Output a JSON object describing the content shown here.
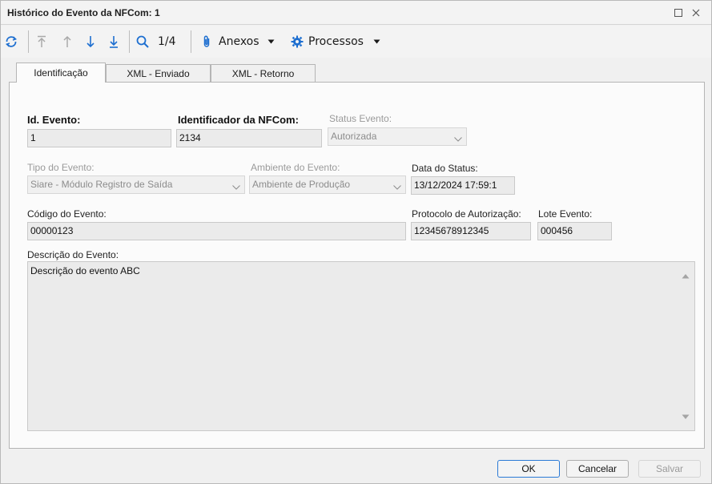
{
  "window": {
    "title": "Histórico do Evento da NFCom: 1"
  },
  "toolbar": {
    "counter": "1/4",
    "anexos_label": "Anexos",
    "processos_label": "Processos"
  },
  "tabs": [
    {
      "label": "Identificação",
      "active": true
    },
    {
      "label": "XML - Enviado",
      "active": false
    },
    {
      "label": "XML - Retorno",
      "active": false
    }
  ],
  "form": {
    "id_evento": {
      "label": "Id. Evento:",
      "value": "1"
    },
    "identificador_nfcom": {
      "label": "Identificador da NFCom:",
      "value": "2134"
    },
    "status_evento": {
      "label": "Status Evento:",
      "value": "Autorizada"
    },
    "tipo_evento": {
      "label": "Tipo do Evento:",
      "value": "Siare - Módulo Registro de Saída"
    },
    "ambiente_evento": {
      "label": "Ambiente do Evento:",
      "value": "Ambiente de Produção"
    },
    "data_status": {
      "label": "Data do Status:",
      "value": "13/12/2024 17:59:1"
    },
    "codigo_evento": {
      "label": "Código do Evento:",
      "value": "00000123"
    },
    "protocolo_autorizacao": {
      "label": "Protocolo de Autorização:",
      "value": "12345678912345"
    },
    "lote_evento": {
      "label": "Lote Evento:",
      "value": "000456"
    },
    "descricao_evento": {
      "label": "Descrição do Evento:",
      "value": "Descrição do evento ABC"
    }
  },
  "buttons": {
    "ok": "OK",
    "cancelar": "Cancelar",
    "salvar": "Salvar"
  },
  "colors": {
    "accent": "#1e6fd0",
    "disabled_text": "#9a9a9a"
  }
}
